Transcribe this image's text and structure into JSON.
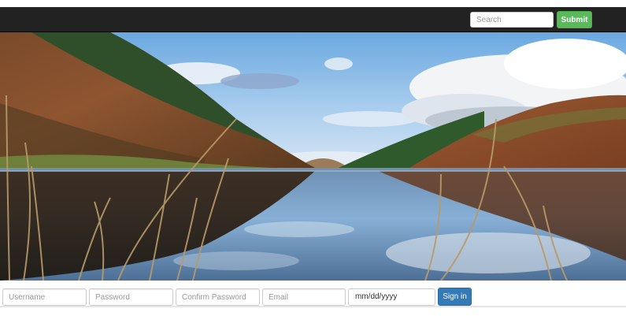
{
  "navbar": {
    "search_placeholder": "Search",
    "submit_label": "Submit",
    "background_color": "#222222",
    "submit_color": "#5cb85c"
  },
  "hero": {
    "description_icon": "landscape-photo"
  },
  "form": {
    "username_placeholder": "Username",
    "password_placeholder": "Password",
    "confirm_password_placeholder": "Confirm Password",
    "email_placeholder": "Email",
    "date_value": "mm/dd/yyyy",
    "signin_label": "Sign in",
    "signin_color": "#337ab7"
  }
}
